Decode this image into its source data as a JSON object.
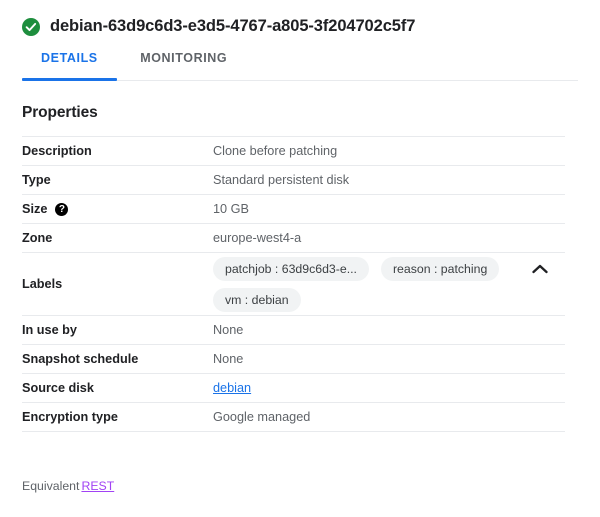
{
  "header": {
    "status_icon": "check-circle-icon",
    "status_color": "#1e8e3e",
    "title": "debian-63d9c6d3-e3d5-4767-a805-3f204702c5f7"
  },
  "tabs": [
    {
      "label": "DETAILS",
      "active": true
    },
    {
      "label": "MONITORING",
      "active": false
    }
  ],
  "accent_color": "#1a73e8",
  "properties": {
    "section_title": "Properties",
    "rows": [
      {
        "key": "Description",
        "value": "Clone before patching"
      },
      {
        "key": "Type",
        "value": "Standard persistent disk"
      },
      {
        "key": "Size",
        "value": "10 GB",
        "help_icon": "help-icon"
      },
      {
        "key": "Zone",
        "value": "europe-west4-a"
      },
      {
        "key": "In use by",
        "value": "None"
      },
      {
        "key": "Snapshot schedule",
        "value": "None"
      },
      {
        "key": "Source disk",
        "value": "debian",
        "link": true
      },
      {
        "key": "Encryption type",
        "value": "Google managed"
      }
    ],
    "labels_row": {
      "key": "Labels",
      "chips": [
        "patchjob : 63d9c6d3-e...",
        "reason : patching",
        "vm : debian"
      ],
      "toggle_icon": "chevron-up-icon"
    }
  },
  "footer": {
    "text": "Equivalent",
    "link_label": "REST",
    "link_color": "#a142f4"
  }
}
